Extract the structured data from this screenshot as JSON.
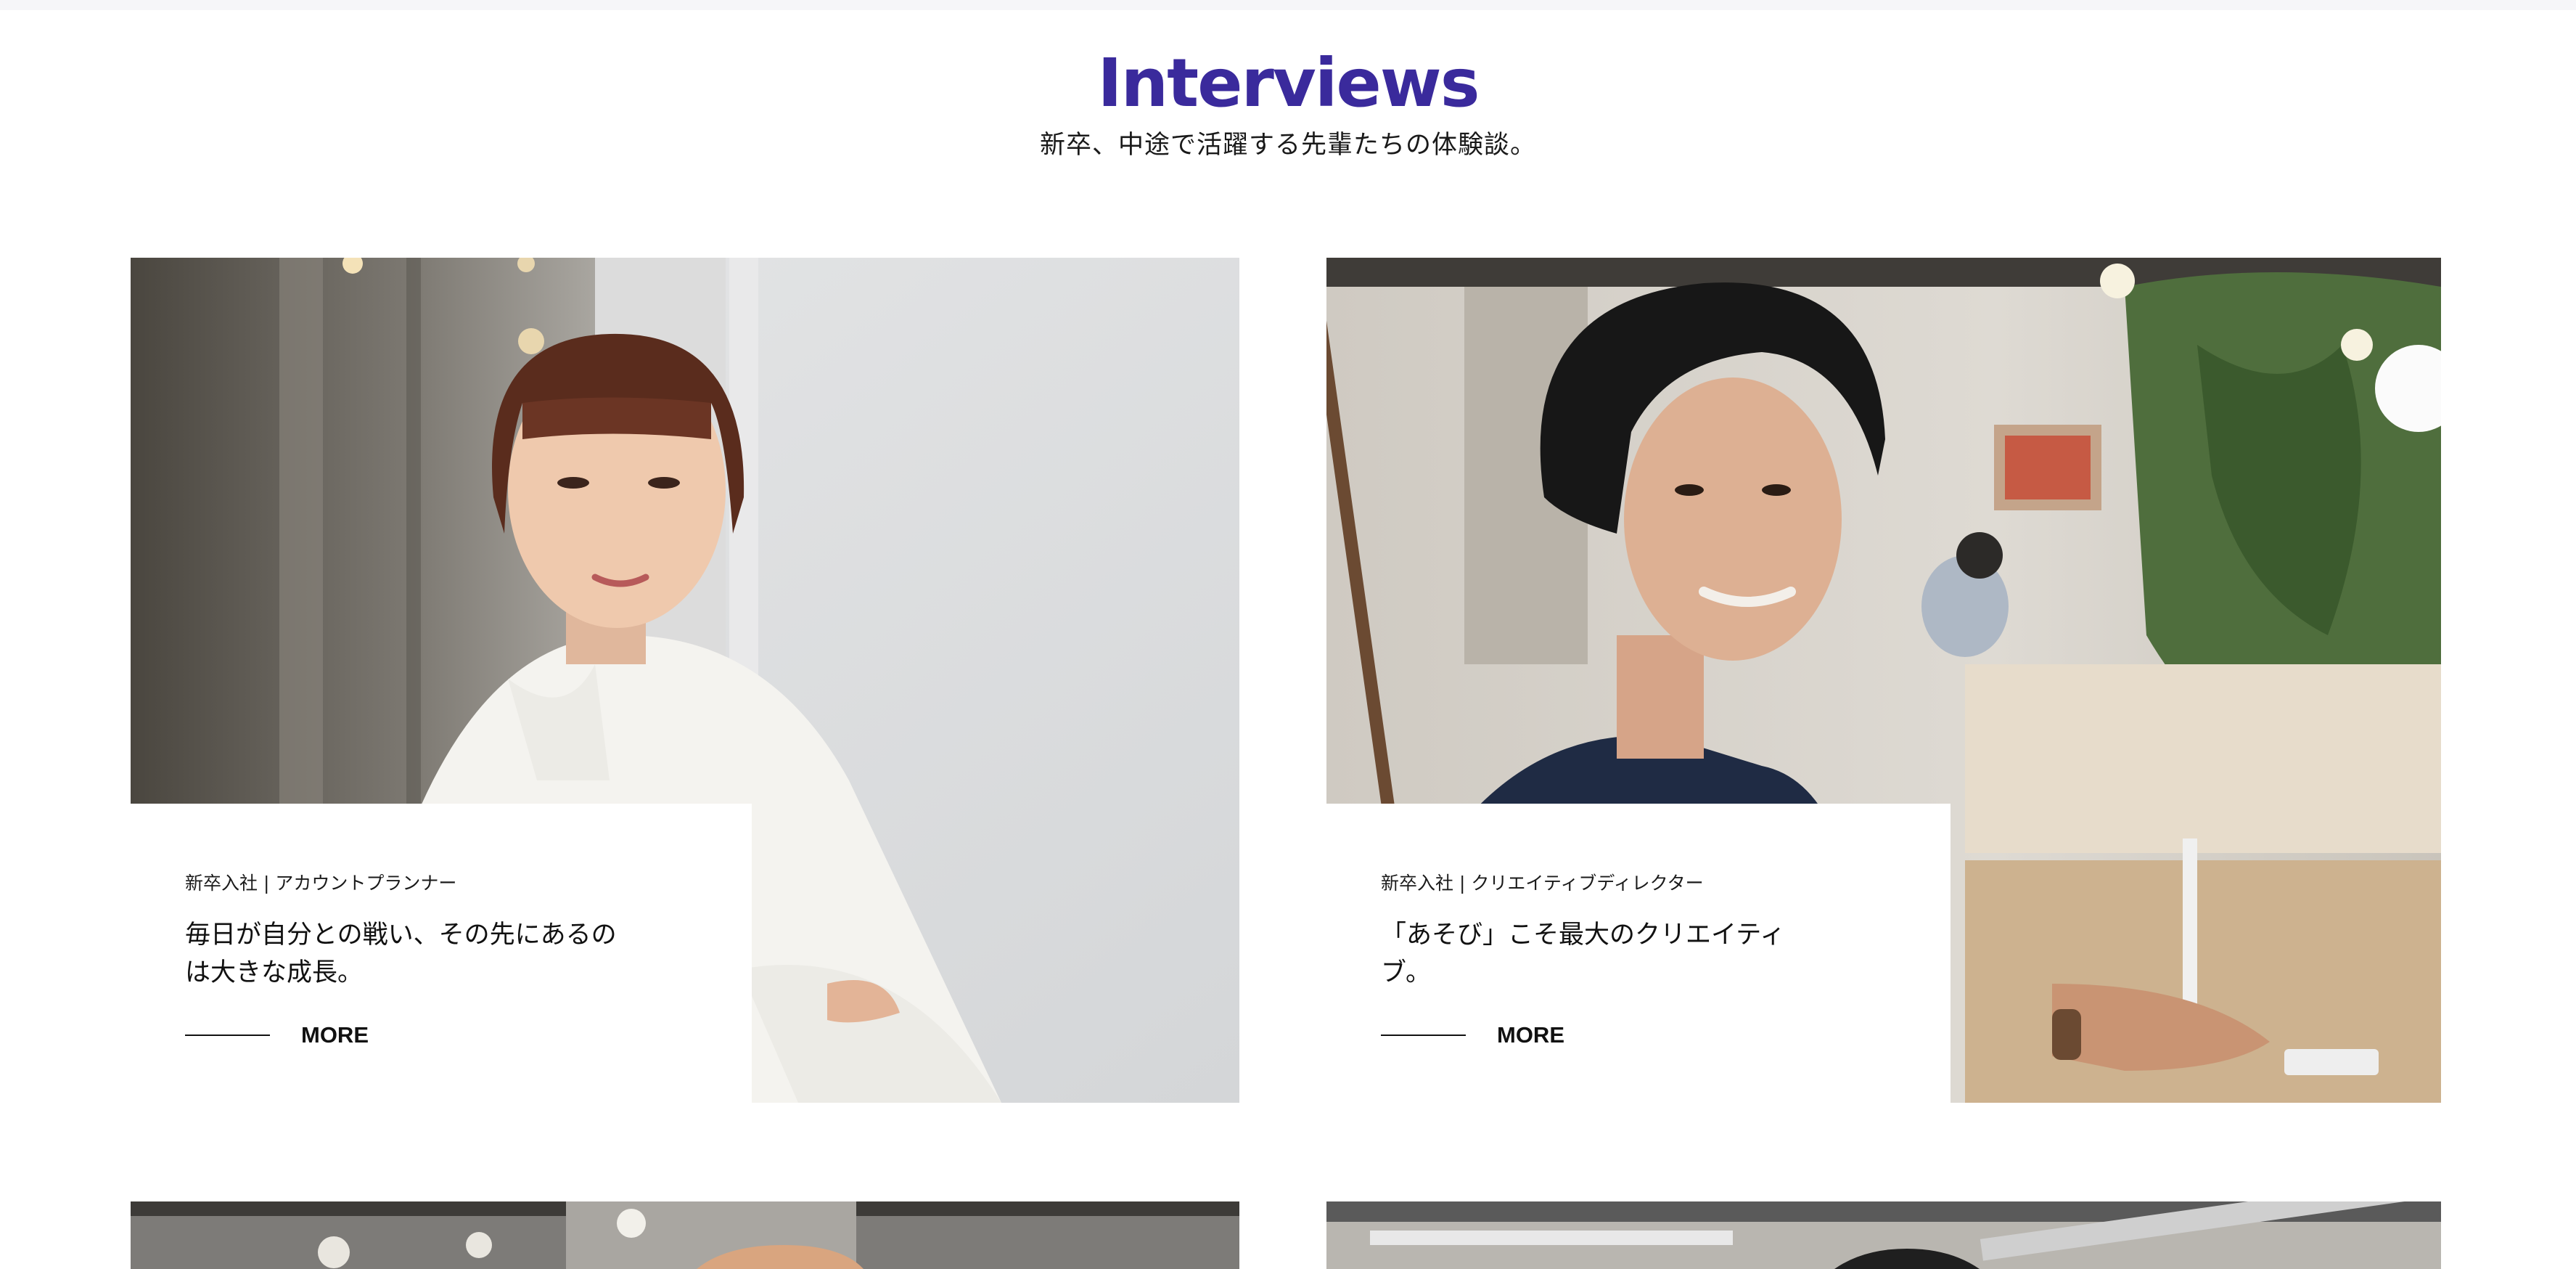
{
  "header": {
    "title": "Interviews",
    "subtitle": "新卒、中途で活躍する先輩たちの体験談。"
  },
  "interviews": [
    {
      "category": "新卒入社 | アカウントプランナー",
      "headline": "毎日が自分との戦い、その先にあるのは大きな成長。",
      "more_label": "MORE"
    },
    {
      "category": "新卒入社 | クリエイティブディレクター",
      "headline": "「あそび」こそ最大のクリエイティブ。",
      "more_label": "MORE"
    }
  ],
  "colors": {
    "accent": "#3a2a9c",
    "text": "#111111",
    "background": "#ffffff"
  }
}
